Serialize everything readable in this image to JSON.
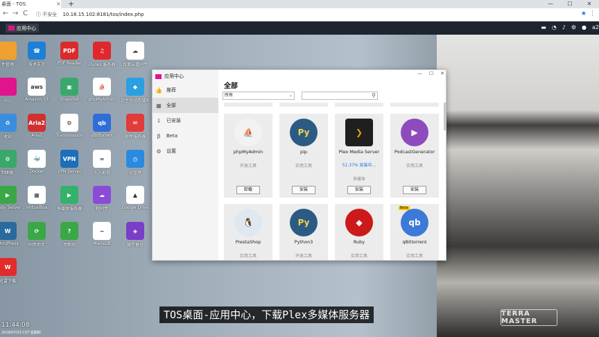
{
  "browser": {
    "tab_title": "桌面 - TOS",
    "tab_close": "×",
    "new_tab": "+",
    "minimize": "—",
    "maximize": "☐",
    "close": "✕",
    "security": "不安全",
    "url": "10.18.15.102:8181/tos/index.php",
    "back_icon": "←",
    "forward_icon": "→",
    "reload_icon": "C",
    "info_icon": "ⓘ",
    "star_icon": "★",
    "menu_icon": "⋮"
  },
  "taskbar": {
    "app_label": "应用中心",
    "right_text": "a2"
  },
  "desktop_icons": [
    {
      "label": "件管理",
      "color": "#f0a030",
      "glyph": ""
    },
    {
      "label": "技术支持",
      "color": "#1e7fd6",
      "glyph": "☎"
    },
    {
      "label": "PDF Reader",
      "color": "#d92b2b",
      "glyph": "PDF"
    },
    {
      "label": "iTunes 服务器",
      "color": "#e0272c",
      "glyph": "♫"
    },
    {
      "label": "百度云盘同步",
      "color": "#ffffff",
      "glyph": "☁"
    },
    {
      "label": "中心",
      "color": "#e0148c",
      "glyph": ""
    },
    {
      "label": "Amazon S3",
      "color": "#ffffff",
      "glyph": "aws"
    },
    {
      "label": "Snapshot",
      "color": "#3aa86b",
      "glyph": "▣"
    },
    {
      "label": "phpMyAdmin",
      "color": "#ffffff",
      "glyph": "⛵"
    },
    {
      "label": "花生壳动态域名",
      "color": "#2aa0e0",
      "glyph": "◆"
    },
    {
      "label": "收站",
      "color": "#3a8ee0",
      "glyph": "♻"
    },
    {
      "label": "Aria2",
      "color": "#d03030",
      "glyph": "Aria2"
    },
    {
      "label": "Transmission",
      "color": "#ffffff",
      "glyph": "⚙"
    },
    {
      "label": "qBittorrent",
      "color": "#2f6ed8",
      "glyph": "qb"
    },
    {
      "label": "邮件服务器",
      "color": "#e23b3b",
      "glyph": "✉"
    },
    {
      "label": "制面板",
      "color": "#3aa86b",
      "glyph": "⚙"
    },
    {
      "label": "Docker",
      "color": "#ffffff",
      "glyph": "🐳"
    },
    {
      "label": "VPN Server",
      "color": "#1c6fb8",
      "glyph": "VPN"
    },
    {
      "label": "人人影视",
      "color": "#ffffff",
      "glyph": "≈"
    },
    {
      "label": "份管理",
      "color": "#2a8ae0",
      "glyph": "◷"
    },
    {
      "label": "Emby Server",
      "color": "#3aa846",
      "glyph": "▶"
    },
    {
      "label": "VirtualBox",
      "color": "#ffffff",
      "glyph": "▦"
    },
    {
      "label": "多媒体服务器",
      "color": "#34b26b",
      "glyph": "▶"
    },
    {
      "label": "程同步",
      "color": "#8a4bd8",
      "glyph": "☁"
    },
    {
      "label": "Google Drive",
      "color": "#ffffff",
      "glyph": "▲"
    },
    {
      "label": "WordPress",
      "color": "#2a6a9e",
      "glyph": "W"
    },
    {
      "label": "同步助手",
      "color": "#3aa846",
      "glyph": "⟳"
    },
    {
      "label": "用帮助",
      "color": "#3aa846",
      "glyph": "?"
    },
    {
      "label": "MariaDB",
      "color": "#ffffff",
      "glyph": "∼"
    },
    {
      "label": "微信备份",
      "color": "#7a3ec8",
      "glyph": "◈"
    },
    {
      "label": "迅雷下载",
      "color": "#e22b2b",
      "glyph": "W"
    }
  ],
  "clock": {
    "time": "11:44:08",
    "date": "2019/07/23 CST 星期四"
  },
  "brand": "TERRA MASTER",
  "subtitle": "TOS桌面-应用中心，下载Plex多媒体服务器",
  "window": {
    "title": "应用中心",
    "controls": [
      "—",
      "☐",
      "✕"
    ],
    "nav": [
      {
        "icon": "👍",
        "label": "推荐",
        "active": false
      },
      {
        "icon": "▦",
        "label": "全部",
        "active": true
      },
      {
        "icon": "⇩",
        "label": "已安装",
        "active": false
      },
      {
        "icon": "β",
        "label": "Beta",
        "active": false
      },
      {
        "icon": "⚙",
        "label": "设置",
        "active": false
      }
    ],
    "heading": "全部",
    "filter_value": "所有",
    "search_placeholder": "",
    "apps": [
      {
        "name": "phpMyAdmin",
        "category": "开发工具",
        "button": "卸载",
        "progress": "",
        "color": "#f2f2f2",
        "glyph": "⛵"
      },
      {
        "name": "pip",
        "category": "实用工具",
        "button": "安装",
        "progress": "",
        "color": "#2b5b84",
        "glyph": "Py"
      },
      {
        "name": "Plex Media Server",
        "category": "多媒体",
        "button": "安装",
        "progress": "51.37% 安装中...",
        "color": "#1f1f1f",
        "glyph": "❯"
      },
      {
        "name": "PodcastGenerator",
        "category": "实用工具",
        "button": "安装",
        "progress": "",
        "color": "#8f4bbd",
        "glyph": "▶"
      },
      {
        "name": "PrestaShop",
        "category": "实用工具",
        "button": "",
        "progress": "",
        "color": "#dfe8ef",
        "glyph": "🐧"
      },
      {
        "name": "Python3",
        "category": "开发工具",
        "button": "",
        "progress": "",
        "color": "#2b5b84",
        "glyph": "Py"
      },
      {
        "name": "Ruby",
        "category": "实用工具",
        "button": "",
        "progress": "",
        "color": "#cc1a1a",
        "glyph": "◆"
      },
      {
        "name": "qBittorrent",
        "category": "实用工具",
        "button": "",
        "progress": "",
        "color": "#3b7ad6",
        "glyph": "qb",
        "badge": "Beta"
      }
    ]
  }
}
